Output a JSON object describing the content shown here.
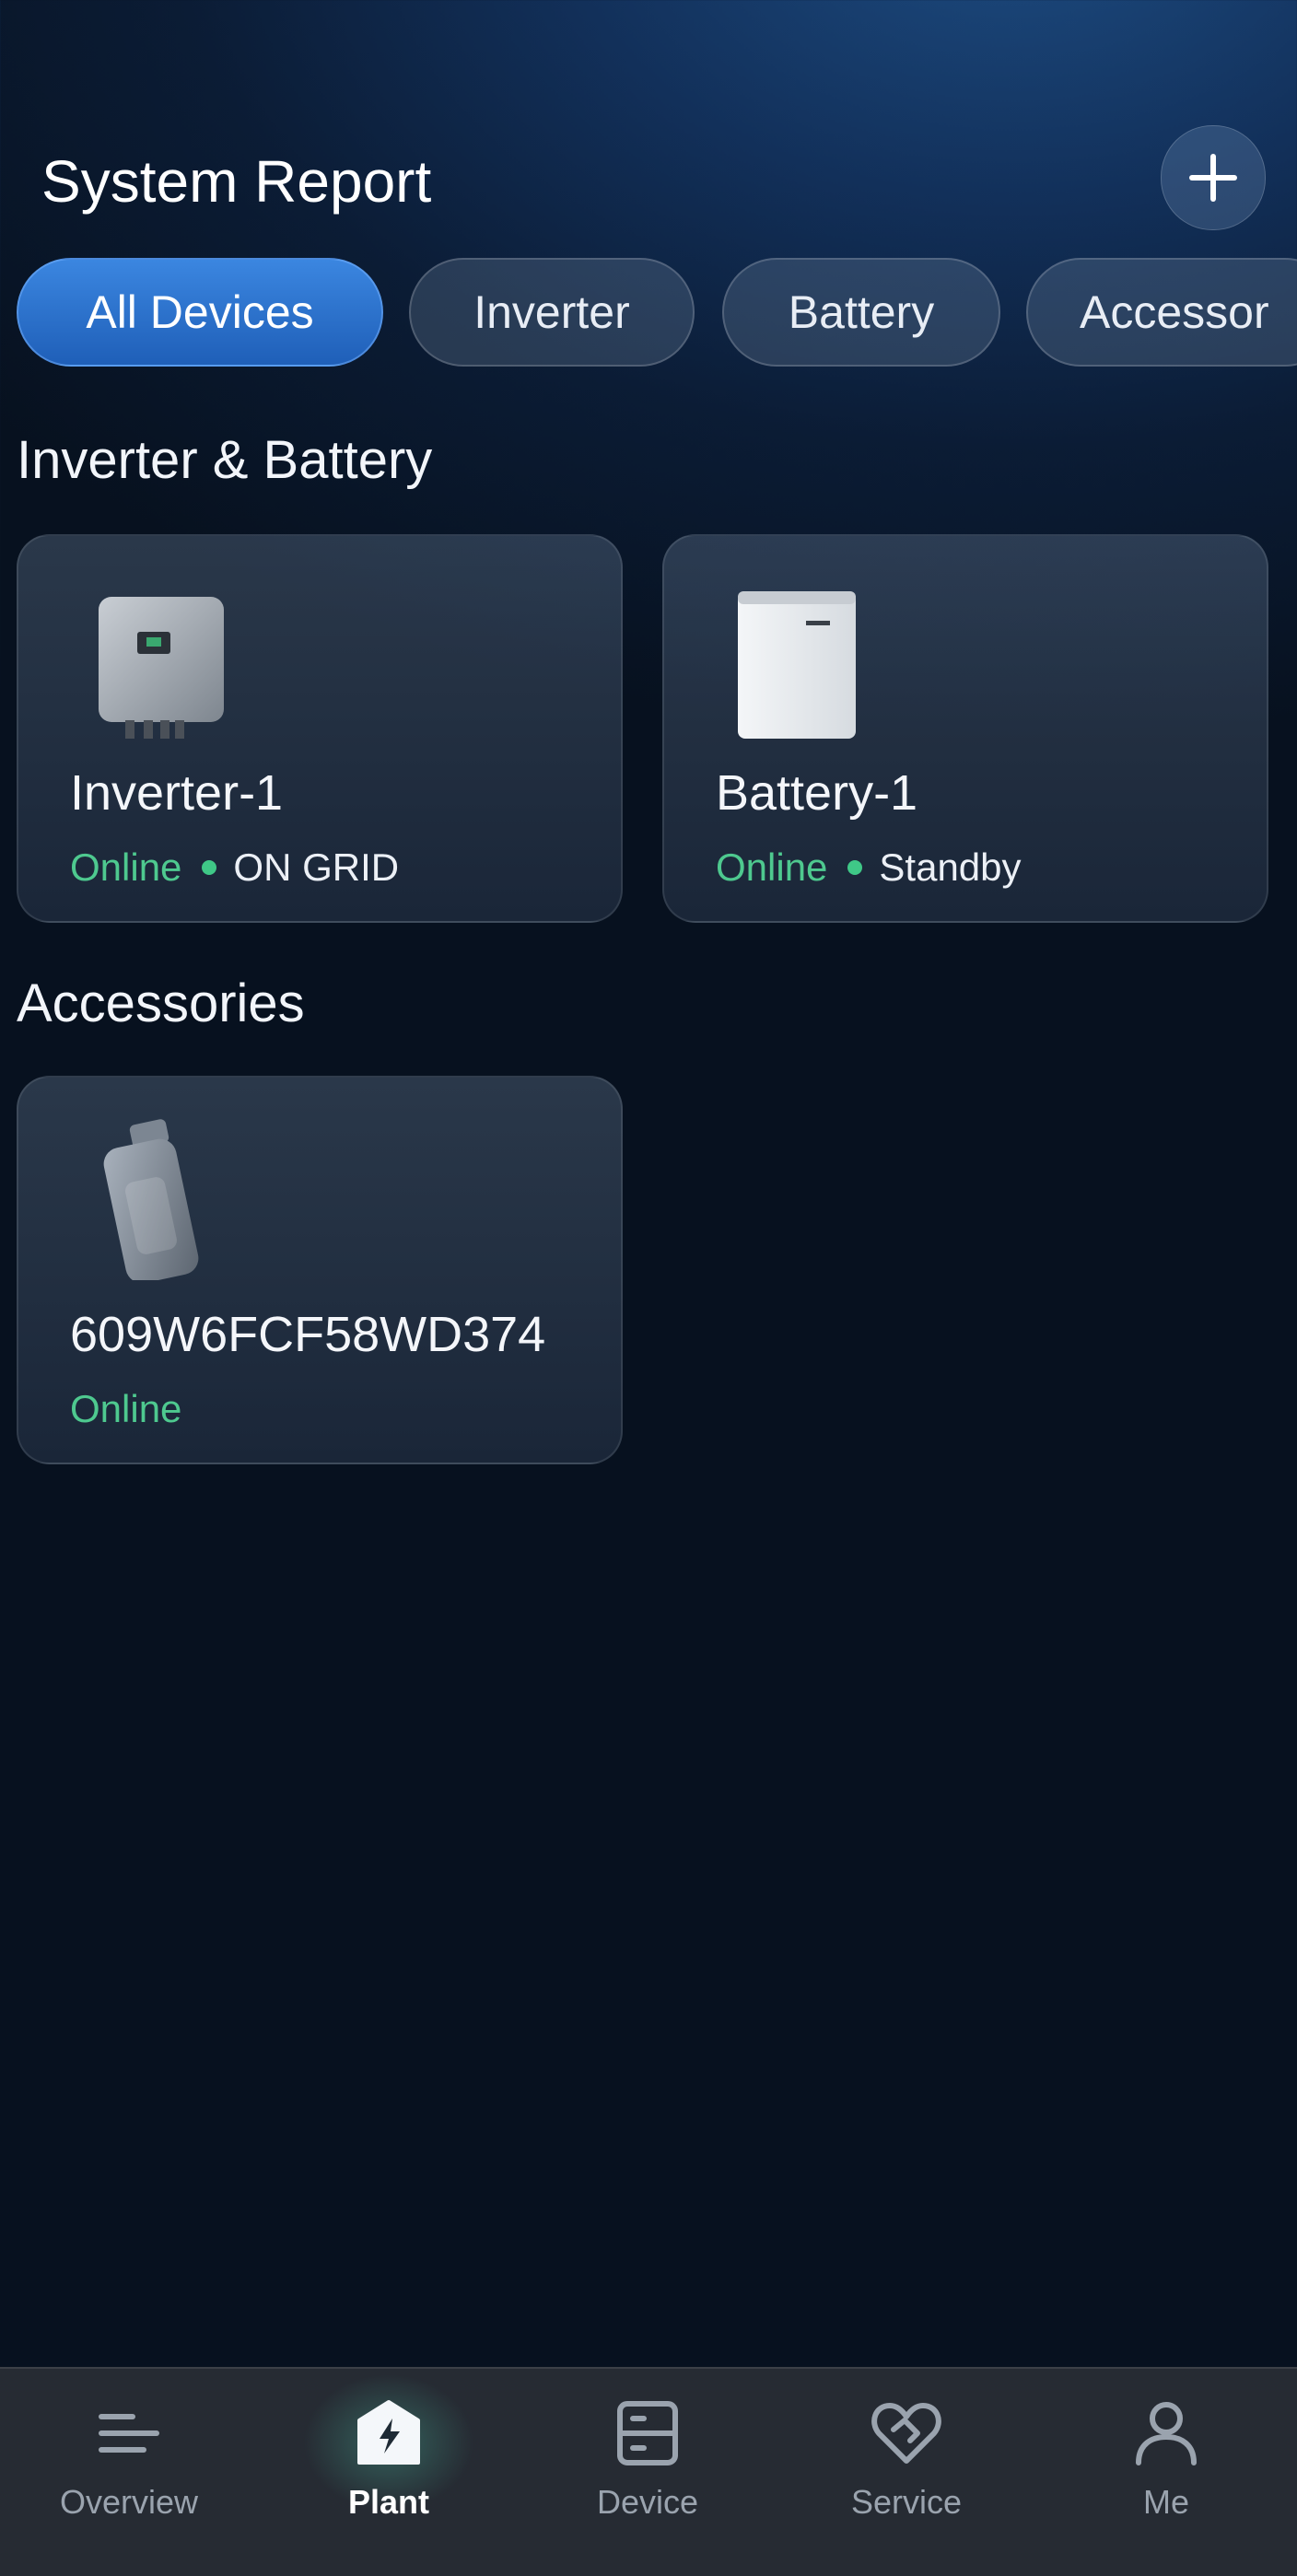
{
  "header": {
    "title": "System Report"
  },
  "filters": [
    {
      "label": "All Devices",
      "active": true
    },
    {
      "label": "Inverter",
      "active": false
    },
    {
      "label": "Battery",
      "active": false
    },
    {
      "label": "Accessor",
      "active": false
    }
  ],
  "sections": {
    "inverter_battery": "Inverter  & Battery",
    "accessories": "Accessories"
  },
  "devices": {
    "inverter": {
      "name": "Inverter-1",
      "status": "Online",
      "mode": "ON GRID",
      "icon": "inverter-icon"
    },
    "battery": {
      "name": "Battery-1",
      "status": "Online",
      "mode": "Standby",
      "icon": "battery-icon"
    },
    "accessory": {
      "name": "609W6FCF58WD374",
      "status": "Online",
      "icon": "dongle-icon"
    }
  },
  "tabs": [
    {
      "label": "Overview",
      "icon": "menu-lines-icon",
      "active": false
    },
    {
      "label": "Plant",
      "icon": "bolt-house-icon",
      "active": true
    },
    {
      "label": "Device",
      "icon": "device-cabinet-icon",
      "active": false
    },
    {
      "label": "Service",
      "icon": "heart-handshake-icon",
      "active": false
    },
    {
      "label": "Me",
      "icon": "person-icon",
      "active": false
    }
  ],
  "colors": {
    "online": "#4ec98f",
    "accent": "#2f74d0",
    "tabbar": "#262b33"
  }
}
